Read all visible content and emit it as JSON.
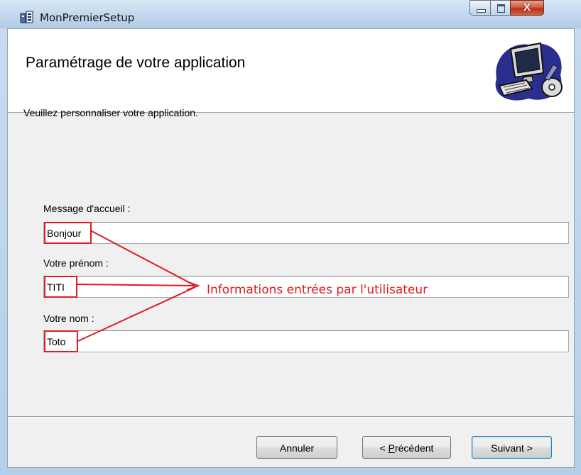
{
  "window": {
    "title": "MonPremierSetup",
    "close_glyph": "X"
  },
  "banner": {
    "title": "Paramétrage de votre application",
    "icon": "computer-setup-icon"
  },
  "main": {
    "instruction": "Veuillez personnaliser votre application.",
    "fields": [
      {
        "label": "Message d'accueil :",
        "value": "Bonjour"
      },
      {
        "label": "Votre prénom :",
        "value": "TITI"
      },
      {
        "label": "Votre nom :",
        "value": "Toto"
      }
    ]
  },
  "annotation": {
    "text": "Informations entrées par l'utilisateur",
    "color": "#e01b24"
  },
  "buttons": {
    "cancel": "Annuler",
    "previous_prefix": "< ",
    "previous_mnemonic": "P",
    "previous_rest": "récédent",
    "next": "Suivant >"
  }
}
